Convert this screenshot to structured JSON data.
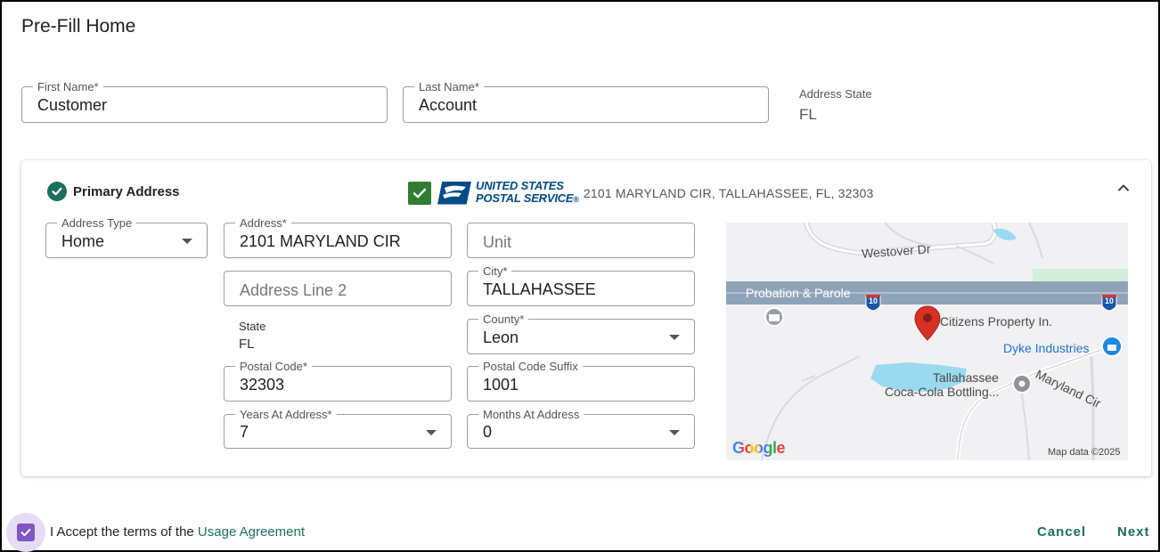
{
  "page_title": "Pre-Fill Home",
  "customer": {
    "first_name_label": "First Name*",
    "first_name_value": "Customer",
    "last_name_label": "Last Name*",
    "last_name_value": "Account",
    "address_state_label": "Address State",
    "address_state_value": "FL"
  },
  "primary_address": {
    "title": "Primary Address",
    "usps": {
      "logo_line1": "UNITED STATES",
      "logo_line2": "POSTAL SERVICE",
      "logo_mark": "®",
      "verified_address": "2101 MARYLAND CIR, TALLAHASSEE, FL, 32303"
    },
    "address_type_label": "Address Type",
    "address_type_value": "Home",
    "address_label": "Address*",
    "address_value": "2101 MARYLAND CIR",
    "unit_placeholder": "Unit",
    "address_line2_placeholder": "Address Line 2",
    "city_label": "City*",
    "city_value": "TALLAHASSEE",
    "state_label": "State",
    "state_value": "FL",
    "county_label": "County*",
    "county_value": "Leon",
    "postal_code_label": "Postal Code*",
    "postal_code_value": "32303",
    "postal_suffix_label": "Postal Code Suffix",
    "postal_suffix_value": "1001",
    "years_label": "Years At Address*",
    "years_value": "7",
    "months_label": "Months At Address",
    "months_value": "0"
  },
  "map": {
    "road_westover": "Westover Dr",
    "place_probation": "Probation & Parole",
    "place_citizens": "Citizens Property In.",
    "place_dyke": "Dyke Industries",
    "place_coca_line1": "Tallahassee",
    "place_coca_line2": "Coca-Cola Bottling...",
    "road_maryland": "Maryland Cir",
    "interstate": "10",
    "google": "Google",
    "attribution": "Map data ©2025"
  },
  "footer": {
    "accept_text": "I Accept the terms of the",
    "accept_link": "Usage Agreement",
    "cancel_label": "Cancel",
    "next_label": "Next"
  },
  "colors": {
    "accent": "#1b6f5c",
    "checkbox": "#7f56c2",
    "usps_blue": "#004b87",
    "map_pin": "#d93025"
  }
}
